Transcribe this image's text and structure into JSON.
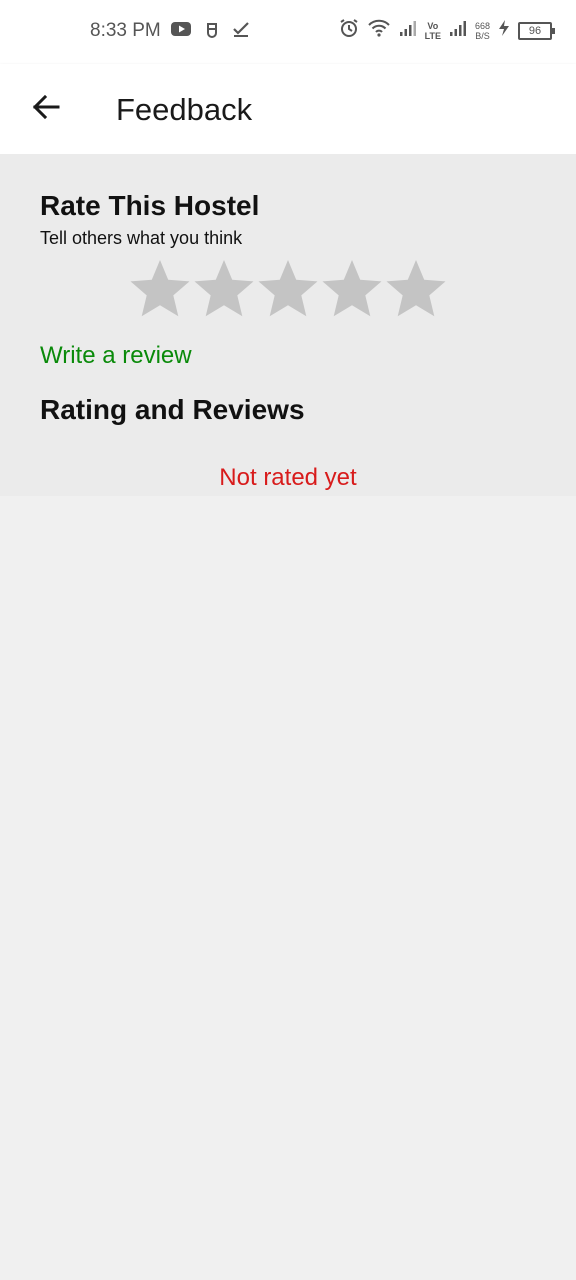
{
  "status_bar": {
    "time": "8:33 PM",
    "network_speed_value": "668",
    "network_speed_unit": "B/S",
    "volte_top": "Vo",
    "volte_bottom": "LTE",
    "battery": "96",
    "icons": [
      "youtube-icon",
      "app-notification-icon",
      "download-complete-icon",
      "alarm-icon",
      "wifi-icon",
      "signal-icon",
      "signal-icon",
      "charging-icon",
      "battery-icon"
    ]
  },
  "header": {
    "title": "Feedback",
    "back_icon": "arrow-left-icon"
  },
  "rating": {
    "title": "Rate This Hostel",
    "subtitle": "Tell others what you think",
    "stars_total": 5,
    "stars_selected": 0,
    "star_color": "#c4c4c4",
    "write_review": "Write a review",
    "write_review_color": "#0a8a0a"
  },
  "reviews": {
    "heading": "Rating and Reviews",
    "empty_text": "Not rated yet",
    "empty_text_color": "#d81b1b"
  }
}
